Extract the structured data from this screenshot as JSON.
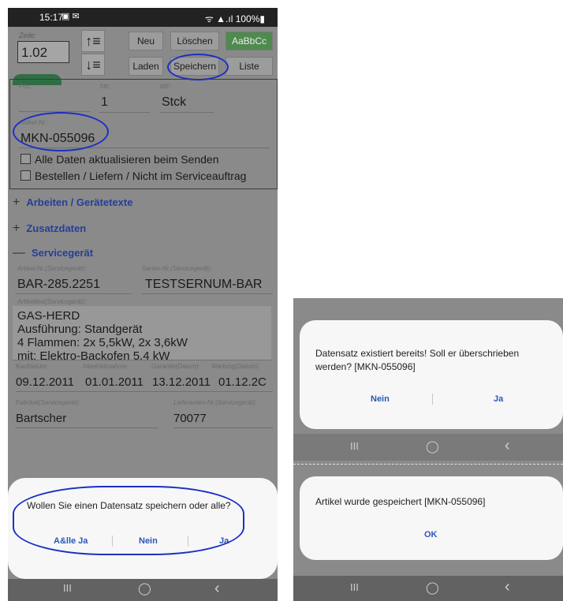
{
  "status_bar": {
    "time": "15:17",
    "left_icons": "▣ ✉",
    "right": "ᯤ ▲.ıl 100%▮"
  },
  "toolbar": {
    "zeile_label": "Zeile:",
    "zeile_value": "1.02",
    "up_glyph": "↑≡",
    "down_glyph": "↓≡",
    "neu": "Neu",
    "loeschen": "Löschen",
    "style": "AaBbCc",
    "laden": "Laden",
    "speichern": "Speichern",
    "liste": "Liste"
  },
  "item": {
    "pos_label": "Pos.:",
    "stk_label": "Stk:",
    "stk_value": "1",
    "me_label": "ME:",
    "me_value": "Stck",
    "artikel_label": "Artikel-Nr.:",
    "artikel_value": "MKN-055096",
    "check1": "Alle Daten aktualisieren beim Senden",
    "check2": "Bestellen / Liefern / Nicht im Serviceauftrag"
  },
  "sections": {
    "arbeiten": "Arbeiten / Gerätetexte",
    "zusatz": "Zusatzdaten",
    "service": "Servicegerät",
    "plus": "+",
    "minus": "—"
  },
  "service": {
    "artikel_label": "Artikel-Nr.(Servicegerät):",
    "artikel_value": "BAR-285.2251",
    "serien_label": "Serien-Nr.(Servicegerät):",
    "serien_value": "TESTSERNUM-BAR",
    "text_label": "Artikeltext(Servicegerät):",
    "text_lines": [
      "GAS-HERD",
      "Ausführung: Standgerät",
      "4 Flammen: 2x 5,5kW, 2x 3,6kW",
      "mit: Elektro-Backofen 5,4 kW"
    ],
    "kauf_label": "Kaufdatum:",
    "kauf_value": "09.12.2011",
    "inbetrieb_label": "Inbetriebnahme:",
    "inbetrieb_value": "01.01.2011",
    "garantie_label": "Garantie(Datum):",
    "garantie_value": "13.12.2011",
    "wartung_label": "Wartung(Datum):",
    "wartung_value": "01.12.2C",
    "fabrikat_label": "Fabrikat(Servicegerät):",
    "fabrikat_value": "Bartscher",
    "lieferant_label": "Lieferanten-Nr.(Servicegerät):",
    "lieferant_value": "70077"
  },
  "dialog_save": {
    "message": "Wollen Sie einen Datensatz speichern oder alle?",
    "btn_all": "A&lle Ja",
    "btn_no": "Nein",
    "btn_yes": "Ja"
  },
  "nav": {
    "recent": "III",
    "home": "◯",
    "back": "‹"
  },
  "dialog_overwrite": {
    "message": "Datensatz existiert bereits! Soll er überschrieben werden? [MKN-055096]",
    "btn_no": "Nein",
    "btn_yes": "Ja"
  },
  "dialog_saved": {
    "message": "Artikel wurde gespeichert [MKN-055096]",
    "btn_ok": "OK"
  }
}
